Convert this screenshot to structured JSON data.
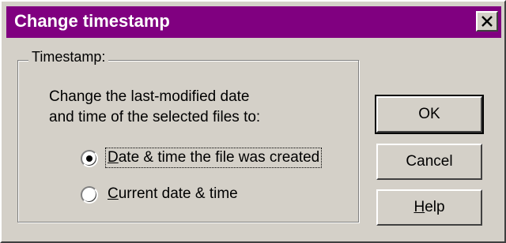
{
  "window": {
    "title": "Change timestamp",
    "close_icon": "close-icon"
  },
  "group": {
    "label": "Timestamp:",
    "description_line1": "Change the last-modified date",
    "description_line2": "and time of the selected files to:"
  },
  "options": [
    {
      "prefix": "",
      "mnemonic": "D",
      "rest": "ate & time the file was created",
      "selected": true
    },
    {
      "prefix": "",
      "mnemonic": "C",
      "rest": "urrent date & time",
      "selected": false
    }
  ],
  "buttons": {
    "ok": "OK",
    "cancel": "Cancel",
    "help_mnemonic": "H",
    "help_rest": "elp"
  },
  "colors": {
    "titlebar": "#800080",
    "face": "#d4d0c8"
  }
}
